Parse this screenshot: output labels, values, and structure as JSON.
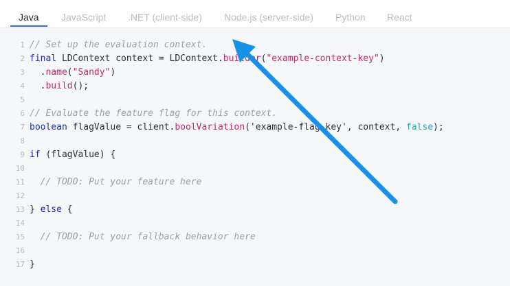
{
  "tabs": [
    {
      "label": "Java",
      "active": true
    },
    {
      "label": "JavaScript",
      "active": false
    },
    {
      "label": ".NET (client-side)",
      "active": false
    },
    {
      "label": "Node.js (server-side)",
      "active": false
    },
    {
      "label": "Python",
      "active": false
    },
    {
      "label": "React",
      "active": false
    }
  ],
  "code": {
    "line_numbers": [
      "1",
      "2",
      "3",
      "4",
      "5",
      "6",
      "7",
      "8",
      "9",
      "10",
      "11",
      "12",
      "13",
      "14",
      "15",
      "16",
      "17"
    ],
    "lines": [
      [
        {
          "t": "comment",
          "v": "// Set up the evaluation context."
        }
      ],
      [
        {
          "t": "keyword",
          "v": "final"
        },
        {
          "t": "plain",
          "v": " LDContext context = LDContext."
        },
        {
          "t": "method",
          "v": "builder"
        },
        {
          "t": "plain",
          "v": "("
        },
        {
          "t": "string",
          "v": "\"example-context-key\""
        },
        {
          "t": "plain",
          "v": ")"
        }
      ],
      [
        {
          "t": "plain",
          "v": "  ."
        },
        {
          "t": "method",
          "v": "name"
        },
        {
          "t": "plain",
          "v": "("
        },
        {
          "t": "string",
          "v": "\"Sandy\""
        },
        {
          "t": "plain",
          "v": ")"
        }
      ],
      [
        {
          "t": "plain",
          "v": "  ."
        },
        {
          "t": "method",
          "v": "build"
        },
        {
          "t": "plain",
          "v": "();"
        }
      ],
      [],
      [
        {
          "t": "comment",
          "v": "// Evaluate the feature flag for this context."
        }
      ],
      [
        {
          "t": "keyword",
          "v": "boolean"
        },
        {
          "t": "plain",
          "v": " flagValue = client."
        },
        {
          "t": "method",
          "v": "boolVariation"
        },
        {
          "t": "plain",
          "v": "('example-flag-key', context, "
        },
        {
          "t": "bool",
          "v": "false"
        },
        {
          "t": "plain",
          "v": ");"
        }
      ],
      [],
      [
        {
          "t": "keyword",
          "v": "if"
        },
        {
          "t": "plain",
          "v": " (flagValue) {"
        }
      ],
      [],
      [
        {
          "t": "comment",
          "v": "  // TODO: Put your feature here"
        }
      ],
      [],
      [
        {
          "t": "plain",
          "v": "} "
        },
        {
          "t": "keyword",
          "v": "else"
        },
        {
          "t": "plain",
          "v": " {"
        }
      ],
      [],
      [
        {
          "t": "comment",
          "v": "  // TODO: Put your fallback behavior here"
        }
      ],
      [],
      [
        {
          "t": "plain",
          "v": "}"
        }
      ]
    ]
  },
  "colors": {
    "accent": "#3e6bd8",
    "annotation_arrow": "#1592e6",
    "comment": "#9aa0a6",
    "keyword": "#1d2bb8",
    "string": "#c4286b",
    "boolean": "#2aa6b8"
  },
  "annotation": {
    "icon": "arrow-annotation"
  }
}
